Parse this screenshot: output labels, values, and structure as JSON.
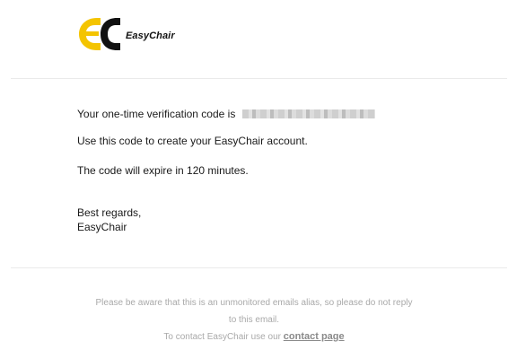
{
  "header": {
    "logo_text": "EasyChair",
    "brand_colors": {
      "yellow": "#f4c400",
      "black": "#111111"
    }
  },
  "body": {
    "code_intro": "Your one-time verification code is",
    "code_value_redacted": true,
    "usage_text": "Use this code to create your EasyChair account.",
    "expiry_text": "The code will expire in 120 minutes.",
    "signoff_greeting": "Best regards,",
    "signoff_name": "EasyChair"
  },
  "footer": {
    "notice_line_1": "Please be aware that this is an unmonitored emails alias, so please do not reply",
    "notice_line_2": "to this email.",
    "contact_prefix": "To contact EasyChair use our",
    "contact_link_text": "contact page"
  }
}
